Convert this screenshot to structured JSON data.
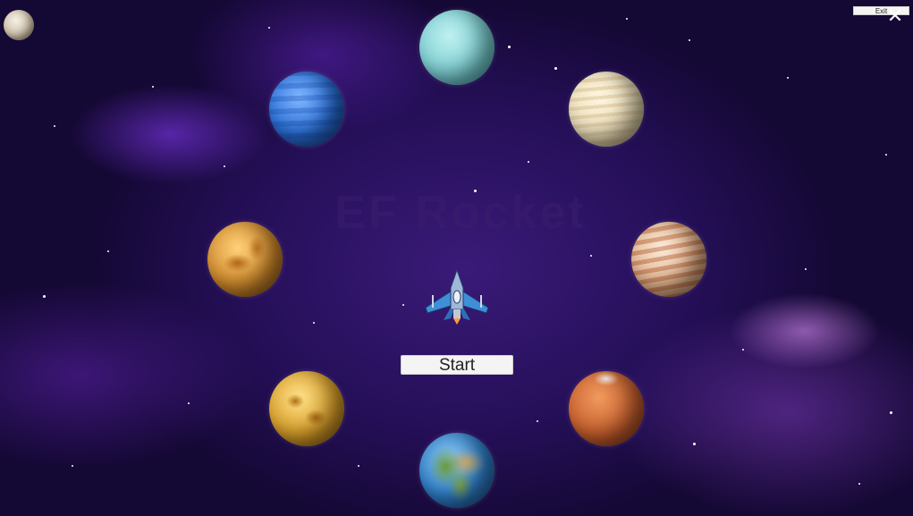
{
  "game": {
    "title": "EF Rocket",
    "start_label": "Start",
    "exit_label": "Exit",
    "close_glyph": "✕"
  },
  "planets": [
    {
      "name": "uranus",
      "color": "#7fd0d4"
    },
    {
      "name": "saturn",
      "color": "#e8dcb8"
    },
    {
      "name": "jupiter",
      "color": "#d9a37a"
    },
    {
      "name": "mars",
      "color": "#c8602e"
    },
    {
      "name": "earth",
      "color": "#2f7fc8"
    },
    {
      "name": "mercury",
      "color": "#d9a02a"
    },
    {
      "name": "venus",
      "color": "#d08a2c"
    },
    {
      "name": "neptune",
      "color": "#2a6fd6"
    }
  ],
  "colors": {
    "space_dark": "#140834",
    "space_purple": "#3a1a78",
    "nebula": "#8c3cff"
  }
}
